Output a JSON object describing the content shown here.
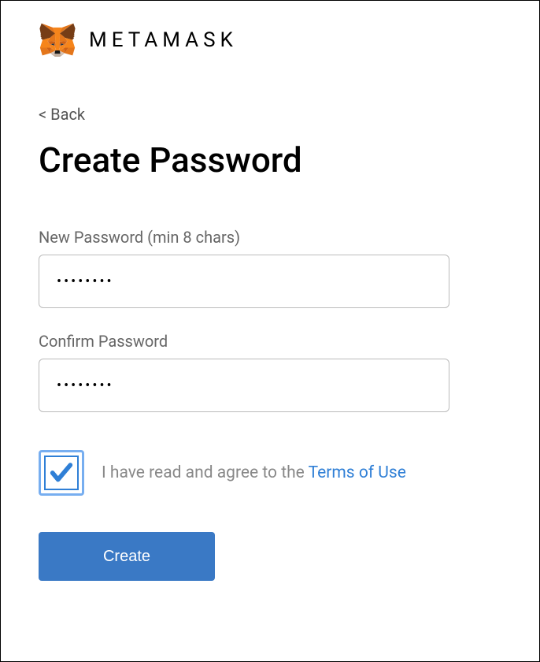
{
  "header": {
    "brand": "METAMASK"
  },
  "nav": {
    "back": "< Back"
  },
  "page": {
    "title": "Create Password"
  },
  "fields": {
    "new_password_label": "New Password (min 8 chars)",
    "new_password_value": "••••••••",
    "confirm_password_label": "Confirm Password",
    "confirm_password_value": "••••••••"
  },
  "agreement": {
    "text_prefix": "I have read and agree to the ",
    "terms_link": "Terms of Use",
    "checked": true
  },
  "buttons": {
    "create": "Create"
  },
  "colors": {
    "primary": "#3a79c5",
    "link": "#2f7fd6"
  }
}
